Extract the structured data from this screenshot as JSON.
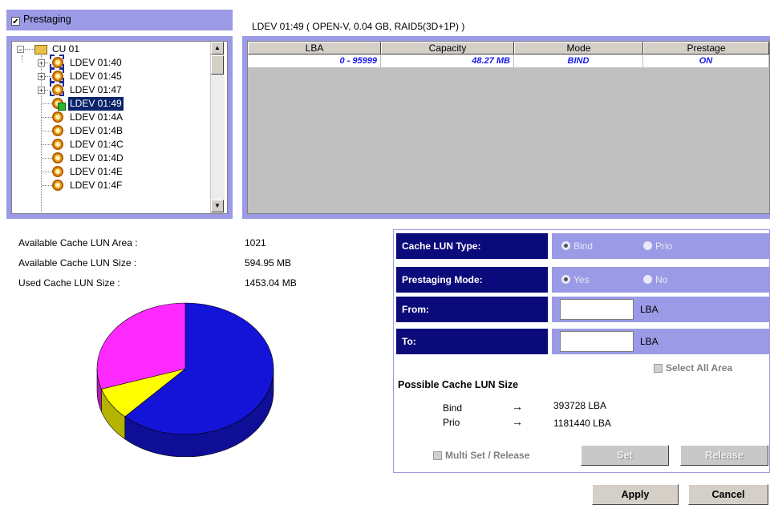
{
  "prestaging": {
    "checked": true,
    "label": "Prestaging"
  },
  "tree": {
    "root": "CU 01",
    "items": [
      {
        "label": "LDEV 01:40",
        "expandable": true
      },
      {
        "label": "LDEV 01:45",
        "expandable": true
      },
      {
        "label": "LDEV 01:47",
        "expandable": true
      },
      {
        "label": "LDEV 01:49",
        "expandable": false,
        "selected": true
      },
      {
        "label": "LDEV 01:4A",
        "expandable": false
      },
      {
        "label": "LDEV 01:4B",
        "expandable": false
      },
      {
        "label": "LDEV 01:4C",
        "expandable": false
      },
      {
        "label": "LDEV 01:4D",
        "expandable": false
      },
      {
        "label": "LDEV 01:4E",
        "expandable": false
      },
      {
        "label": "LDEV 01:4F",
        "expandable": false
      }
    ]
  },
  "ldev_title": "LDEV 01:49 ( OPEN-V, 0.04 GB, RAID5(3D+1P) )",
  "table": {
    "headers": [
      "LBA",
      "Capacity",
      "Mode",
      "Prestage"
    ],
    "rows": [
      [
        "0 - 95999",
        "48.27 MB",
        "BIND",
        "ON"
      ]
    ]
  },
  "cache_info": {
    "available_area_label": "Available Cache LUN Area :",
    "available_area_value": "1021",
    "available_size_label": "Available Cache LUN Size :",
    "available_size_value": "594.95 MB",
    "used_size_label": "Used Cache LUN Size :",
    "used_size_value": "1453.04 MB"
  },
  "pie": {
    "slices": [
      {
        "color": "#1414d8",
        "fraction": 0.62
      },
      {
        "color": "#ffff00",
        "fraction": 0.08
      },
      {
        "color": "#ff2aff",
        "fraction": 0.3
      }
    ]
  },
  "settings": {
    "cache_lun_type_label": "Cache LUN Type:",
    "bind_label": "Bind",
    "prio_label": "Prio",
    "prestaging_mode_label": "Prestaging Mode:",
    "yes_label": "Yes",
    "no_label": "No",
    "from_label": "From:",
    "to_label": "To:",
    "lba_unit": "LBA",
    "select_all_label": "Select All Area",
    "possible_title": "Possible Cache LUN Size",
    "bind_row_label": "Bind",
    "bind_row_value": "393728 LBA",
    "prio_row_label": "Prio",
    "prio_row_value": "1181440 LBA",
    "arrow": "→",
    "multi_label": "Multi Set / Release",
    "set_label": "Set",
    "release_label": "Release"
  },
  "buttons": {
    "apply": "Apply",
    "cancel": "Cancel"
  },
  "colors": {
    "frame": "#9a9ae6",
    "label_bg": "#0a0a7a",
    "data_text": "#1a1aee"
  }
}
